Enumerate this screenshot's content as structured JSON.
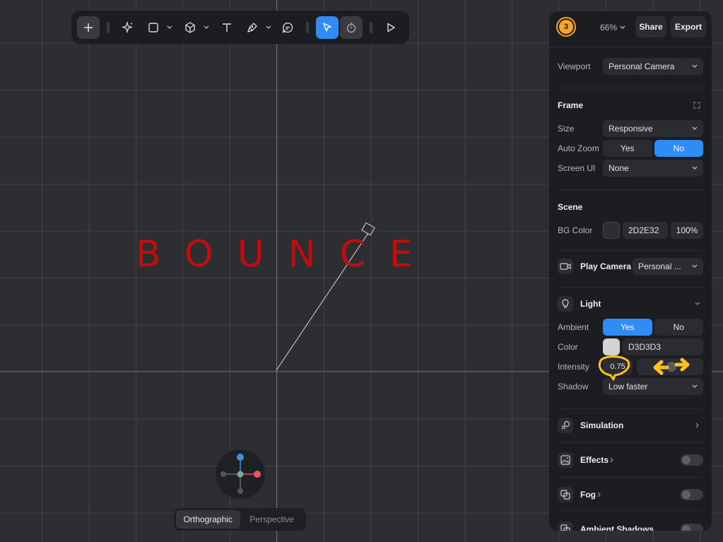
{
  "canvas": {
    "text": "BOUNCE"
  },
  "toolbar": {
    "items": [
      "add-icon",
      "ai-sparkle-icon",
      "rectangle-icon",
      "cube-icon",
      "text-icon",
      "pen-icon",
      "comment-icon",
      "select-icon",
      "timer-icon",
      "play-icon"
    ]
  },
  "view": {
    "orthographic": "Orthographic",
    "perspective": "Perspective",
    "selected": "Orthographic"
  },
  "header": {
    "avatar": "3",
    "zoom": "66%",
    "share": "Share",
    "export": "Export"
  },
  "viewport": {
    "label": "Viewport",
    "value": "Personal Camera"
  },
  "frame": {
    "title": "Frame",
    "size_label": "Size",
    "size_value": "Responsive",
    "autozoom_label": "Auto Zoom",
    "autozoom_yes": "Yes",
    "autozoom_no": "No",
    "autozoom_selected": "No",
    "screenui_label": "Screen UI",
    "screenui_value": "None"
  },
  "scene": {
    "title": "Scene",
    "bgcolor_label": "BG Color",
    "bgcolor_hex": "2D2E32",
    "bgcolor_opacity": "100%",
    "bgcolor_swatch": "#2d2e32"
  },
  "play_camera": {
    "label": "Play Camera",
    "value": "Personal ..."
  },
  "light": {
    "title": "Light",
    "ambient_label": "Ambient",
    "ambient_yes": "Yes",
    "ambient_no": "No",
    "ambient_selected": "Yes",
    "color_label": "Color",
    "color_hex": "D3D3D3",
    "color_swatch": "#d3d3d3",
    "intensity_label": "Intensity",
    "intensity_value": "0.75",
    "intensity_fraction": 0.75,
    "shadow_label": "Shadow",
    "shadow_value": "Low faster"
  },
  "sections": {
    "simulation": "Simulation",
    "effects": "Effects",
    "fog": "Fog",
    "ambient_shadows": "Ambient Shadows"
  },
  "colors": {
    "accent": "#2f8cf6",
    "annotation": "#ffc21a",
    "text_red": "#c00d0d"
  }
}
